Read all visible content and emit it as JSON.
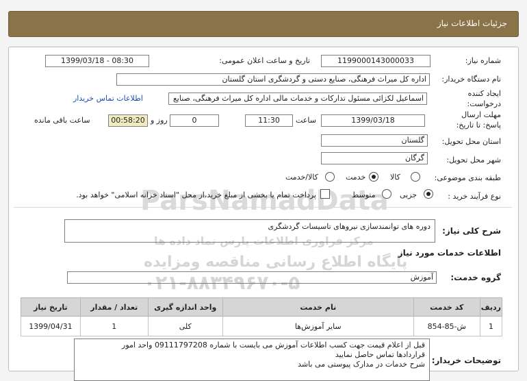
{
  "header": {
    "title": "جزئیات اطلاعات نیاز"
  },
  "fields": {
    "need_number_label": "شماره نیاز:",
    "need_number": "1199000143000033",
    "announce_label": "تاریخ و ساعت اعلان عمومی:",
    "announce_value": "1399/03/18 - 08:30",
    "buyer_label": "نام دستگاه خریدار:",
    "buyer_value": "اداره کل میراث فرهنگی، صنایع دستی و گردشگری استان گلستان",
    "creator_label": "ایجاد کننده درخواست:",
    "creator_value": "اسماعیل لکزائی مسئول تدارکات و خدمات مالی اداره کل میراث فرهنگی، صنایع",
    "contact_link": "اطلاعات تماس خریدار",
    "deadline_label": "مهلت ارسال پاسخ: تا تاریخ:",
    "deadline_date": "1399/03/18",
    "hour_label": "ساعت",
    "deadline_time": "11:30",
    "days_value": "0",
    "days_label": "روز و",
    "remaining_time": "00:58:20",
    "remaining_label": "ساعت باقی مانده",
    "province_label": "استان محل تحویل:",
    "province_value": "گلستان",
    "city_label": "شهر محل تحویل:",
    "city_value": "گرگان",
    "category_label": "طبقه بندی موضوعی:",
    "category_options": [
      "کالا",
      "خدمت",
      "کالا/خدمت"
    ],
    "category_selected": "خدمت",
    "process_label": "نوع فرآیند خرید :",
    "process_options": [
      "جزیی",
      "متوسط"
    ],
    "process_selected": "جزیی",
    "payment_note": "پرداخت تمام یا بخشی از مبلغ خرید،از محل \"اسناد خزانه اسلامی\" خواهد بود."
  },
  "summary": {
    "label": "شرح کلی نیاز:",
    "value": "دوره های توانمندسازی نیروهای تاسیسات گردشگری"
  },
  "services": {
    "section_title": "اطلاعات خدمات مورد نیاز",
    "group_label": "گروه خدمت:",
    "group_value": "آموزش",
    "columns": [
      "ردیف",
      "کد خدمت",
      "نام خدمت",
      "واحد اندازه گیری",
      "تعداد / مقدار",
      "تاریخ نیاز"
    ],
    "rows": [
      [
        "1",
        "ش-85-854",
        "سایر آموزش‌ها",
        "کلی",
        "1",
        "1399/04/31"
      ]
    ]
  },
  "buyer_notes": {
    "label": "توضیحات خریدار:",
    "lines": [
      "قبل از اعلام قیمت جهت کسب اطلاعات آموزش می بایست با شماره 09111797208 واحد امور",
      "قراردادها تماس حاصل نمایید",
      "شرح خدمات در مدارک پیوستی می باشد"
    ]
  },
  "watermark": {
    "line1": "ParsNamadData",
    "line2": "مرکز فراوری اطلاعات پارس نماد داده ها",
    "line3": "پایگاه اطلاع رسانی مناقصه ومزایده",
    "line4": "۰۲۱-۸۸۳۴۹۶۷۰-۵"
  },
  "colors": {
    "header_bg": "#8a7348",
    "accent_link": "#1a4fb0",
    "remaining_bg": "#f0ecbf"
  }
}
